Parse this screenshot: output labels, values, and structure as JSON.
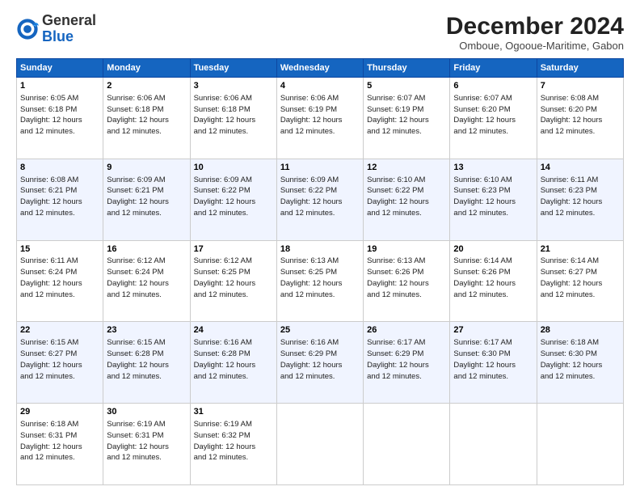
{
  "logo": {
    "general": "General",
    "blue": "Blue"
  },
  "header": {
    "month": "December 2024",
    "location": "Omboue, Ogooue-Maritime, Gabon"
  },
  "days_of_week": [
    "Sunday",
    "Monday",
    "Tuesday",
    "Wednesday",
    "Thursday",
    "Friday",
    "Saturday"
  ],
  "weeks": [
    [
      {
        "day": "1",
        "sunrise": "6:05 AM",
        "sunset": "6:18 PM",
        "daylight": "12 hours and 12 minutes."
      },
      {
        "day": "2",
        "sunrise": "6:06 AM",
        "sunset": "6:18 PM",
        "daylight": "12 hours and 12 minutes."
      },
      {
        "day": "3",
        "sunrise": "6:06 AM",
        "sunset": "6:18 PM",
        "daylight": "12 hours and 12 minutes."
      },
      {
        "day": "4",
        "sunrise": "6:06 AM",
        "sunset": "6:19 PM",
        "daylight": "12 hours and 12 minutes."
      },
      {
        "day": "5",
        "sunrise": "6:07 AM",
        "sunset": "6:19 PM",
        "daylight": "12 hours and 12 minutes."
      },
      {
        "day": "6",
        "sunrise": "6:07 AM",
        "sunset": "6:20 PM",
        "daylight": "12 hours and 12 minutes."
      },
      {
        "day": "7",
        "sunrise": "6:08 AM",
        "sunset": "6:20 PM",
        "daylight": "12 hours and 12 minutes."
      }
    ],
    [
      {
        "day": "8",
        "sunrise": "6:08 AM",
        "sunset": "6:21 PM",
        "daylight": "12 hours and 12 minutes."
      },
      {
        "day": "9",
        "sunrise": "6:09 AM",
        "sunset": "6:21 PM",
        "daylight": "12 hours and 12 minutes."
      },
      {
        "day": "10",
        "sunrise": "6:09 AM",
        "sunset": "6:22 PM",
        "daylight": "12 hours and 12 minutes."
      },
      {
        "day": "11",
        "sunrise": "6:09 AM",
        "sunset": "6:22 PM",
        "daylight": "12 hours and 12 minutes."
      },
      {
        "day": "12",
        "sunrise": "6:10 AM",
        "sunset": "6:22 PM",
        "daylight": "12 hours and 12 minutes."
      },
      {
        "day": "13",
        "sunrise": "6:10 AM",
        "sunset": "6:23 PM",
        "daylight": "12 hours and 12 minutes."
      },
      {
        "day": "14",
        "sunrise": "6:11 AM",
        "sunset": "6:23 PM",
        "daylight": "12 hours and 12 minutes."
      }
    ],
    [
      {
        "day": "15",
        "sunrise": "6:11 AM",
        "sunset": "6:24 PM",
        "daylight": "12 hours and 12 minutes."
      },
      {
        "day": "16",
        "sunrise": "6:12 AM",
        "sunset": "6:24 PM",
        "daylight": "12 hours and 12 minutes."
      },
      {
        "day": "17",
        "sunrise": "6:12 AM",
        "sunset": "6:25 PM",
        "daylight": "12 hours and 12 minutes."
      },
      {
        "day": "18",
        "sunrise": "6:13 AM",
        "sunset": "6:25 PM",
        "daylight": "12 hours and 12 minutes."
      },
      {
        "day": "19",
        "sunrise": "6:13 AM",
        "sunset": "6:26 PM",
        "daylight": "12 hours and 12 minutes."
      },
      {
        "day": "20",
        "sunrise": "6:14 AM",
        "sunset": "6:26 PM",
        "daylight": "12 hours and 12 minutes."
      },
      {
        "day": "21",
        "sunrise": "6:14 AM",
        "sunset": "6:27 PM",
        "daylight": "12 hours and 12 minutes."
      }
    ],
    [
      {
        "day": "22",
        "sunrise": "6:15 AM",
        "sunset": "6:27 PM",
        "daylight": "12 hours and 12 minutes."
      },
      {
        "day": "23",
        "sunrise": "6:15 AM",
        "sunset": "6:28 PM",
        "daylight": "12 hours and 12 minutes."
      },
      {
        "day": "24",
        "sunrise": "6:16 AM",
        "sunset": "6:28 PM",
        "daylight": "12 hours and 12 minutes."
      },
      {
        "day": "25",
        "sunrise": "6:16 AM",
        "sunset": "6:29 PM",
        "daylight": "12 hours and 12 minutes."
      },
      {
        "day": "26",
        "sunrise": "6:17 AM",
        "sunset": "6:29 PM",
        "daylight": "12 hours and 12 minutes."
      },
      {
        "day": "27",
        "sunrise": "6:17 AM",
        "sunset": "6:30 PM",
        "daylight": "12 hours and 12 minutes."
      },
      {
        "day": "28",
        "sunrise": "6:18 AM",
        "sunset": "6:30 PM",
        "daylight": "12 hours and 12 minutes."
      }
    ],
    [
      {
        "day": "29",
        "sunrise": "6:18 AM",
        "sunset": "6:31 PM",
        "daylight": "12 hours and 12 minutes."
      },
      {
        "day": "30",
        "sunrise": "6:19 AM",
        "sunset": "6:31 PM",
        "daylight": "12 hours and 12 minutes."
      },
      {
        "day": "31",
        "sunrise": "6:19 AM",
        "sunset": "6:32 PM",
        "daylight": "12 hours and 12 minutes."
      },
      null,
      null,
      null,
      null
    ]
  ],
  "labels": {
    "sunrise": "Sunrise: ",
    "sunset": "Sunset: ",
    "daylight": "Daylight: "
  }
}
